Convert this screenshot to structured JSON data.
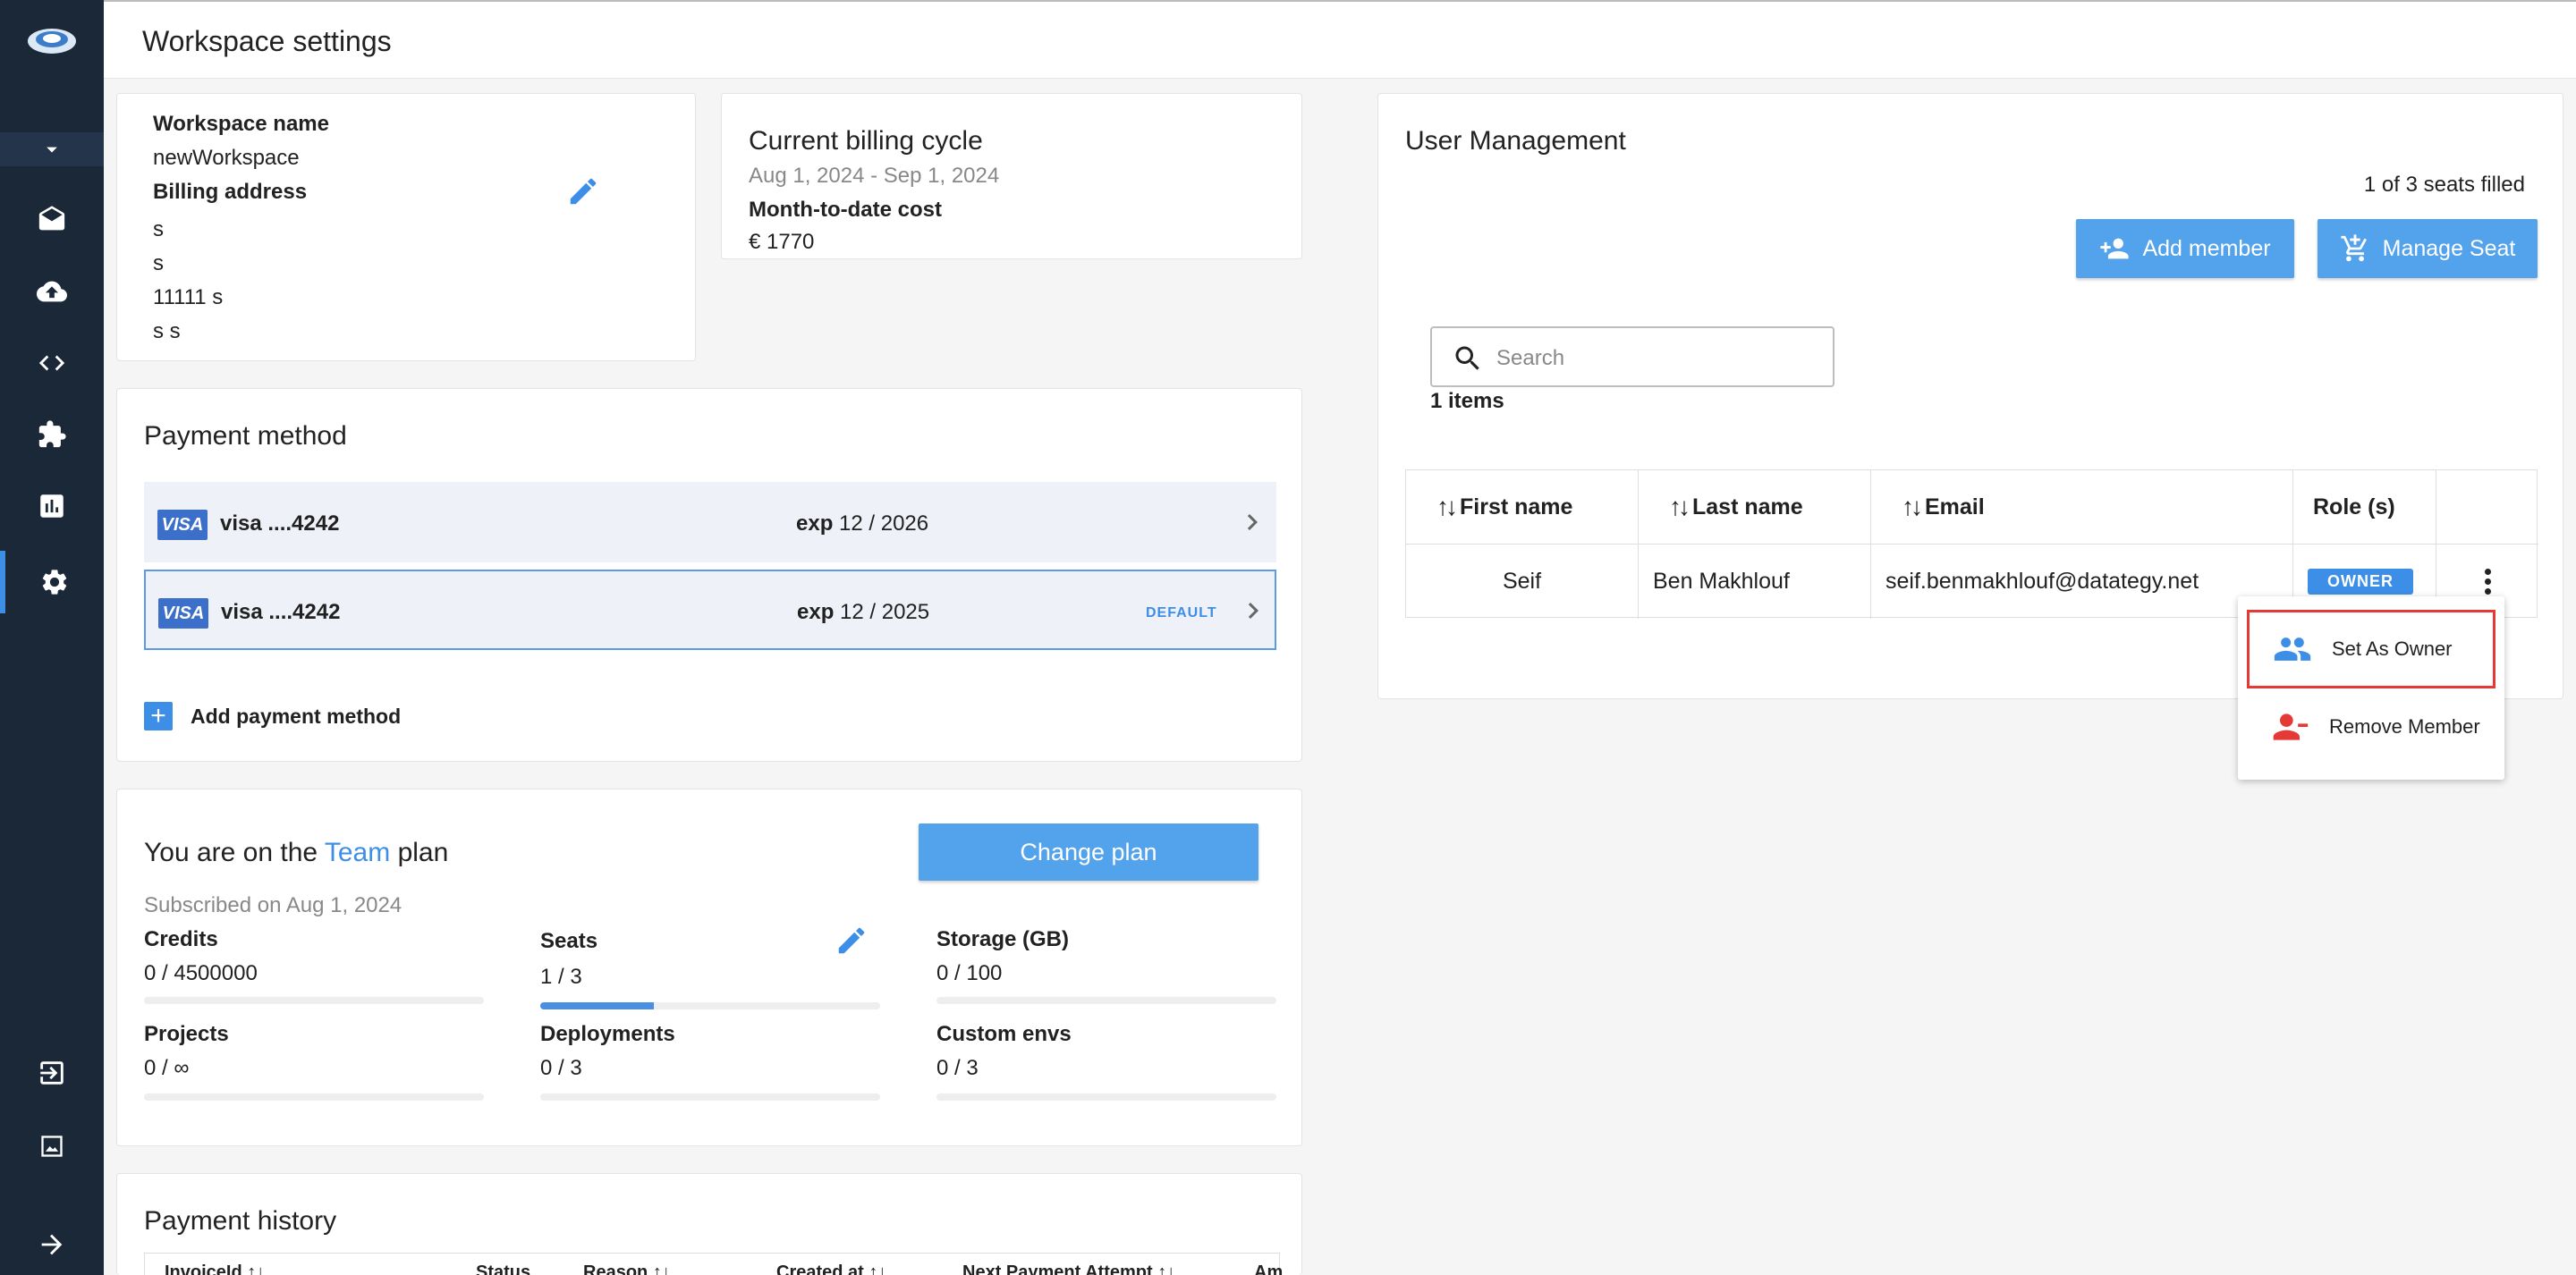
{
  "page": {
    "title": "Workspace settings"
  },
  "workspace": {
    "name_label": "Workspace name",
    "name": "newWorkspace",
    "billing_label": "Billing address",
    "address_lines": [
      "s",
      "s",
      "11111 s",
      "s s"
    ]
  },
  "billing": {
    "title": "Current billing cycle",
    "period": "Aug 1, 2024 - Sep 1, 2024",
    "cost_label": "Month-to-date cost",
    "cost": "€ 1770"
  },
  "payment": {
    "title": "Payment method",
    "cards": [
      {
        "brand": "VISA",
        "number": "visa ....4242",
        "exp_label": "exp",
        "exp": "12 / 2026",
        "default": ""
      },
      {
        "brand": "VISA",
        "number": "visa ....4242",
        "exp_label": "exp",
        "exp": "12 / 2025",
        "default": "DEFAULT"
      }
    ],
    "add_label": "Add payment method"
  },
  "plan": {
    "prefix": "You are on the",
    "name": "Team",
    "suffix": "plan",
    "subscribed": "Subscribed on Aug 1, 2024",
    "change_label": "Change plan",
    "stats": [
      {
        "label": "Credits",
        "value": "0 / 4500000",
        "fill": 0
      },
      {
        "label": "Seats",
        "value": "1 / 3",
        "fill": 0.333
      },
      {
        "label": "Storage (GB)",
        "value": "0 / 100",
        "fill": 0
      },
      {
        "label": "Projects",
        "value": "0 / ∞",
        "fill": 0
      },
      {
        "label": "Deployments",
        "value": "0 / 3",
        "fill": 0
      },
      {
        "label": "Custom envs",
        "value": "0 / 3",
        "fill": 0
      }
    ]
  },
  "history": {
    "title": "Payment history",
    "columns": [
      "InvoiceId",
      "Status",
      "Reason",
      "Created at",
      "Next Payment Attempt",
      "Am"
    ]
  },
  "users": {
    "title": "User Management",
    "seats": "1 of 3 seats filled",
    "add_member": "Add member",
    "manage_seat": "Manage Seat",
    "search_placeholder": "Search",
    "items_count": "1 items",
    "columns": [
      "First name",
      "Last name",
      "Email",
      "Role (s)"
    ],
    "rows": [
      {
        "first": "Seif",
        "last": "Ben Makhlouf",
        "email": "seif.benmakhlouf@datategy.net",
        "role": "OWNER"
      }
    ]
  },
  "menu": {
    "items": [
      {
        "label": "Set As Owner",
        "icon": "group-icon",
        "color": "#3d8ee6"
      },
      {
        "label": "Remove Member",
        "icon": "person-remove-icon",
        "color": "#e53935"
      }
    ]
  },
  "colors": {
    "accent": "#3d8ee6",
    "sidebar": "#1b2838",
    "danger": "#e53935"
  }
}
